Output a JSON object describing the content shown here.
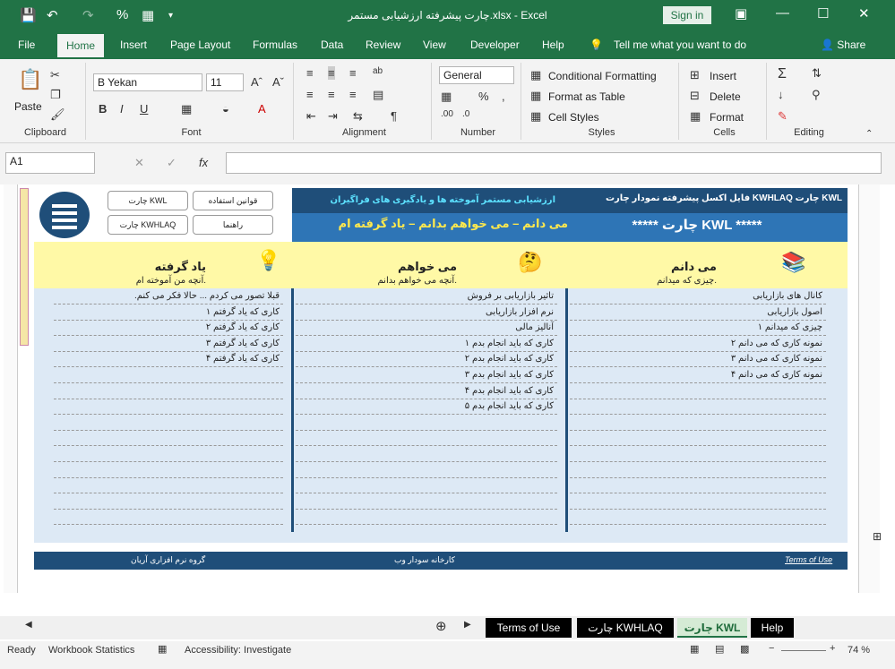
{
  "window": {
    "title": "چارت پیشرفته ارزشیابی مستمر.xlsx  -  Excel",
    "signin": "Sign in"
  },
  "tabs": [
    "File",
    "Home",
    "Insert",
    "Page Layout",
    "Formulas",
    "Data",
    "Review",
    "View",
    "Developer",
    "Help"
  ],
  "tell_me": "Tell me what you want to do",
  "share": "Share",
  "ribbon": {
    "paste": "Paste",
    "font_name": "B Yekan",
    "font_size": "11",
    "number_format": "General",
    "conditional": "Conditional Formatting",
    "format_table": "Format as Table",
    "cell_styles": "Cell Styles",
    "insert": "Insert",
    "delete": "Delete",
    "format": "Format",
    "groups": {
      "clipboard": "Clipboard",
      "font": "Font",
      "alignment": "Alignment",
      "number": "Number",
      "styles": "Styles",
      "cells": "Cells",
      "editing": "Editing"
    }
  },
  "namebox": "A1",
  "sheet": {
    "btn_kwl": "چارت KWL",
    "btn_rules": "قوانین استفاده",
    "btn_kwhlaq": "چارت KWHLAQ",
    "btn_guide": "راهنما",
    "header_top": "فایل اکسل پیشرفته نمودار   چارت  KWHLAQ   چارت KWL",
    "header_top2": "ارزشیابی مستمر آموخته ها و یادگیری های فراگیران",
    "header_bottom": "***** چارت KWL *****",
    "header_bottom2": "می دانم  – می خواهم بدانم  – یاد گرفته ام",
    "col_know": "می دانم",
    "col_know_sub": "چیزی که میدانم.",
    "col_want": "می خواهم",
    "col_want_sub": "آنچه می خواهم بدانم.",
    "col_learn": "یاد گرفته",
    "col_learn_sub": "آنچه من آموخته ام.",
    "know": [
      "کانال های بازاریابی",
      "اصول بازاریابی",
      "چیزی که میدانم ۱",
      "نمونه کاری که می دانم ۲",
      "نمونه کاری که می دانم ۳",
      "نمونه کاری که می دانم ۴"
    ],
    "want": [
      "تاثیر بازاریابی بر فروش",
      "نرم افزار بازاریابی",
      "آنالیز مالی",
      "کاری که باید انجام بدم ۱",
      "کاری که باید انجام بدم ۲",
      "کاری که باید انجام بدم ۳",
      "کاری که باید انجام بدم ۴",
      "کاری که باید انجام بدم ۵"
    ],
    "learn": [
      "قبلا تصور می کردم ... حالا فکر می کنم.",
      "کاری که یاد گرفتم ۱",
      "کاری که یاد گرفتم ۲",
      "کاری که یاد گرفتم ۳",
      "کاری که یاد گرفتم ۴"
    ],
    "footer_terms": "Terms of Use",
    "footer_mid": "کارخانه سودار وب",
    "footer_right": "گروه نرم افزاری آریان"
  },
  "sheet_tabs": [
    "Terms of Use",
    "چارت KWHLAQ",
    "چارت KWL",
    "Help"
  ],
  "status": {
    "ready": "Ready",
    "stats": "Workbook Statistics",
    "access": "Accessibility: Investigate",
    "zoom": "74 %"
  }
}
